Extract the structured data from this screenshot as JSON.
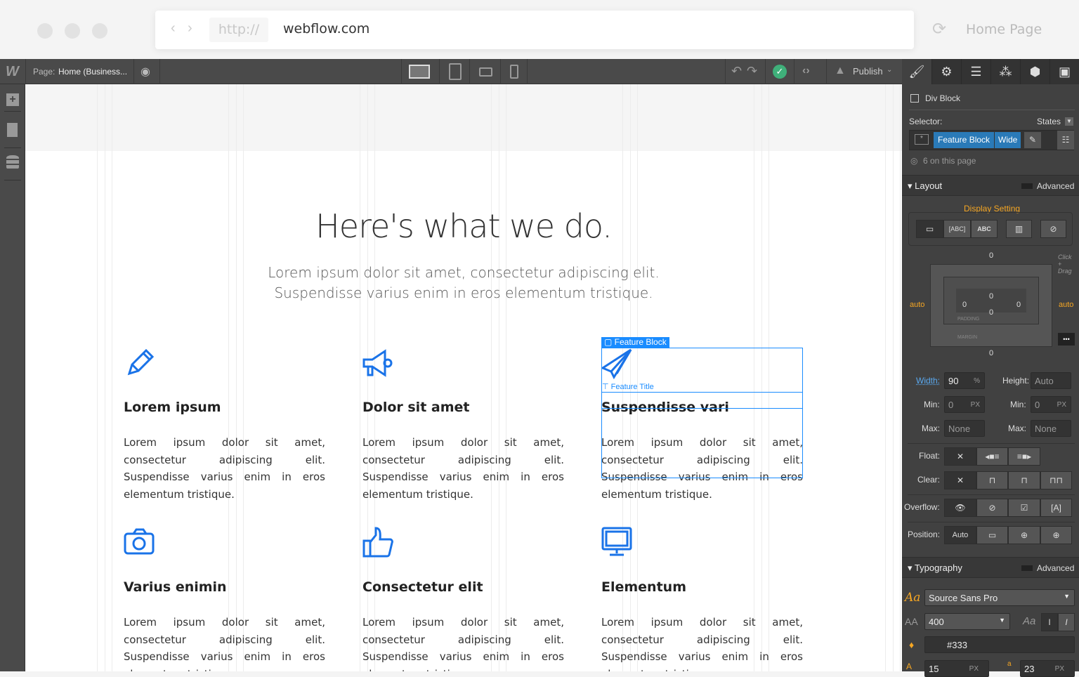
{
  "browser": {
    "url_scheme": "http://",
    "url": "webflow.com",
    "page_title": "Home Page"
  },
  "toolbar": {
    "page_label": "Page:",
    "page_name": "Home (Business...",
    "publish_label": "Publish",
    "devices": [
      "desktop",
      "tablet",
      "mobile-landscape",
      "mobile-portrait"
    ]
  },
  "canvas": {
    "heading": "Here's what we do.",
    "lead_1": "Lorem ipsum dolor sit amet, consectetur adipiscing elit.",
    "lead_2": "Suspendisse varius enim in eros elementum tristique.",
    "features": [
      {
        "icon": "pencil-icon",
        "title": "Lorem ipsum",
        "body": "Lorem ipsum dolor sit amet, consectetur adipiscing elit. Suspendisse varius enim in eros elementum tristique."
      },
      {
        "icon": "megaphone-icon",
        "title": "Dolor sit amet",
        "body": "Lorem ipsum dolor sit amet, consectetur adipiscing elit. Suspendisse varius enim in eros elementum tristique."
      },
      {
        "icon": "paper-plane-icon",
        "title": "Suspendisse vari",
        "body": "Lorem ipsum dolor sit amet, consectetur adipiscing elit. Suspendisse varius enim in eros elementum tristique."
      },
      {
        "icon": "camera-icon",
        "title": "Varius enimin",
        "body": "Lorem ipsum dolor sit amet, consectetur adipiscing elit. Suspendisse varius enim in eros elementum tristique."
      },
      {
        "icon": "thumbs-up-icon",
        "title": "Consectetur elit",
        "body": "Lorem ipsum dolor sit amet, consectetur adipiscing elit. Suspendisse varius enim in eros elementum tristique."
      },
      {
        "icon": "monitor-icon",
        "title": "Elementum",
        "body": "Lorem ipsum dolor sit amet, consectetur adipiscing elit. Suspendisse varius enim in eros elementum tristique."
      }
    ],
    "selection_label": "Feature Block",
    "title_label": "Feature Title",
    "accent": "#1a8cff"
  },
  "panel": {
    "element": "Div Block",
    "selector_label": "Selector:",
    "states_label": "States",
    "classes": [
      "Feature Block",
      "Wide"
    ],
    "count_text": "6 on this page",
    "layout": {
      "title": "Layout",
      "advanced": "Advanced",
      "display_setting": "Display Setting",
      "display_options": [
        "block",
        "inline-block",
        "inline",
        "flex",
        "none"
      ],
      "margin_top": "0",
      "margin_bottom": "0",
      "margin_left": "auto",
      "margin_right": "auto",
      "padding_top": "0",
      "padding_bottom": "0",
      "padding_left": "0",
      "padding_right": "0",
      "padding_label": "PADDING",
      "margin_label": "MARGIN",
      "hint": "Click + Drag",
      "width_label": "Width:",
      "width": "90",
      "width_unit": "%",
      "height_label": "Height:",
      "height": "Auto",
      "height_unit": "-",
      "min_label": "Min:",
      "min_w": "0",
      "min_h": "0",
      "px": "PX",
      "max_label": "Max:",
      "max_w": "None",
      "max_h": "None",
      "dash": "-",
      "float_label": "Float:",
      "clear_label": "Clear:",
      "overflow_label": "Overflow:",
      "position_label": "Position:",
      "position_auto": "Auto",
      "x": "✕"
    },
    "typography": {
      "title": "Typography",
      "advanced": "Advanced",
      "font": "Source Sans Pro",
      "weight": "400",
      "color": "#333",
      "size": "15",
      "line_height": "23",
      "px": "PX"
    }
  }
}
